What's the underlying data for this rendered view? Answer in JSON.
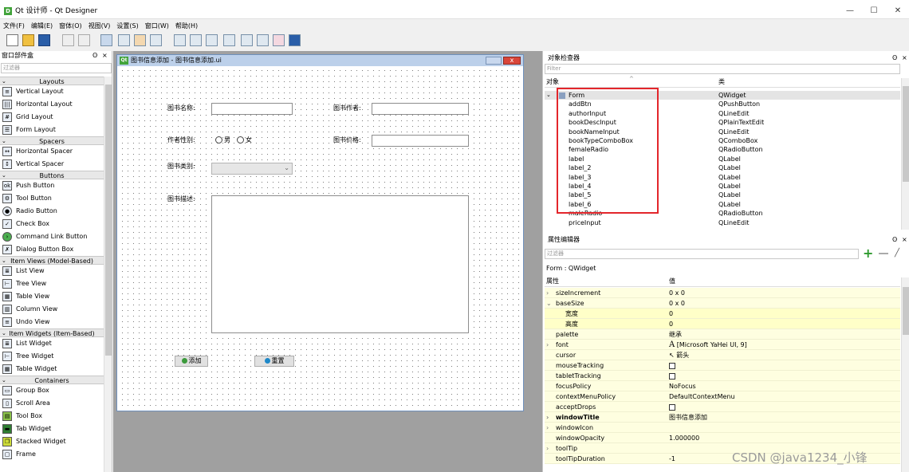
{
  "window": {
    "title": "Qt 设计师 - Qt Designer",
    "icon": "D",
    "minimize": "—",
    "maximize": "☐",
    "close": "✕"
  },
  "menu": [
    "文件(F)",
    "编辑(E)",
    "窗体(O)",
    "视图(V)",
    "设置(S)",
    "窗口(W)",
    "帮助(H)"
  ],
  "widget_box": {
    "title": "窗口部件盒",
    "float_icon": "ʘ",
    "close_icon": "×",
    "filter_placeholder": "过滤器",
    "sections": [
      {
        "name": "Layouts",
        "items": [
          "Vertical Layout",
          "Horizontal Layout",
          "Grid Layout",
          "Form Layout"
        ]
      },
      {
        "name": "Spacers",
        "items": [
          "Horizontal Spacer",
          "Vertical Spacer"
        ]
      },
      {
        "name": "Buttons",
        "items": [
          "Push Button",
          "Tool Button",
          "Radio Button",
          "Check Box",
          "Command Link Button",
          "Dialog Button Box"
        ]
      },
      {
        "name": "Item Views (Model-Based)",
        "items": [
          "List View",
          "Tree View",
          "Table View",
          "Column View",
          "Undo View"
        ]
      },
      {
        "name": "Item Widgets (Item-Based)",
        "items": [
          "List Widget",
          "Tree Widget",
          "Table Widget"
        ]
      },
      {
        "name": "Containers",
        "items": [
          "Group Box",
          "Scroll Area",
          "Tool Box",
          "Tab Widget",
          "Stacked Widget",
          "Frame"
        ]
      }
    ]
  },
  "form": {
    "title": "图书信息添加 - 图书信息添加.ui",
    "qt_badge": "Qt",
    "labels": {
      "book_name": "图书名称:",
      "author": "图书作者:",
      "author_sex": "作者性别:",
      "price": "图书价格:",
      "book_type": "图书类别:",
      "book_desc": "图书描述:"
    },
    "radio_male": "男",
    "radio_female": "女",
    "add_button": "添加",
    "reset_button": "重置"
  },
  "object_inspector": {
    "title": "对象检查器",
    "filter_placeholder": "Filter",
    "col_object": "对象",
    "col_class": "类",
    "rows": [
      {
        "name": "Form",
        "cls": "QWidget"
      },
      {
        "name": "addBtn",
        "cls": "QPushButton"
      },
      {
        "name": "authorInput",
        "cls": "QLineEdit"
      },
      {
        "name": "bookDescInput",
        "cls": "QPlainTextEdit"
      },
      {
        "name": "bookNameInput",
        "cls": "QLineEdit"
      },
      {
        "name": "bookTypeComboBox",
        "cls": "QComboBox"
      },
      {
        "name": "femaleRadio",
        "cls": "QRadioButton"
      },
      {
        "name": "label",
        "cls": "QLabel"
      },
      {
        "name": "label_2",
        "cls": "QLabel"
      },
      {
        "name": "label_3",
        "cls": "QLabel"
      },
      {
        "name": "label_4",
        "cls": "QLabel"
      },
      {
        "name": "label_5",
        "cls": "QLabel"
      },
      {
        "name": "label_6",
        "cls": "QLabel"
      },
      {
        "name": "maleRadio",
        "cls": "QRadioButton"
      },
      {
        "name": "priceInput",
        "cls": "QLineEdit"
      }
    ]
  },
  "property_editor": {
    "title": "属性编辑器",
    "filter_placeholder": "过滤器",
    "context": "Form : QWidget",
    "col_property": "属性",
    "col_value": "值",
    "rows": [
      {
        "name": "sizeIncrement",
        "value": "0 x 0",
        "exp": "›"
      },
      {
        "name": "baseSize",
        "value": "0 x 0",
        "exp": "⌄"
      },
      {
        "name": "宽度",
        "value": "0",
        "exp": ""
      },
      {
        "name": "高度",
        "value": "0",
        "exp": ""
      },
      {
        "name": "palette",
        "value": "继承",
        "exp": ""
      },
      {
        "name": "font",
        "value": "[Microsoft YaHei UI, 9]",
        "exp": "›"
      },
      {
        "name": "cursor",
        "value": "箭头",
        "exp": ""
      },
      {
        "name": "mouseTracking",
        "value": "",
        "exp": ""
      },
      {
        "name": "tabletTracking",
        "value": "",
        "exp": ""
      },
      {
        "name": "focusPolicy",
        "value": "NoFocus",
        "exp": ""
      },
      {
        "name": "contextMenuPolicy",
        "value": "DefaultContextMenu",
        "exp": ""
      },
      {
        "name": "acceptDrops",
        "value": "",
        "exp": ""
      },
      {
        "name": "windowTitle",
        "value": "图书信息添加",
        "exp": "›"
      },
      {
        "name": "windowIcon",
        "value": "",
        "exp": "›"
      },
      {
        "name": "windowOpacity",
        "value": "1.000000",
        "exp": ""
      },
      {
        "name": "toolTip",
        "value": "",
        "exp": "›"
      },
      {
        "name": "toolTipDuration",
        "value": "-1",
        "exp": ""
      }
    ]
  },
  "watermark": "CSDN @java1234_小锋"
}
